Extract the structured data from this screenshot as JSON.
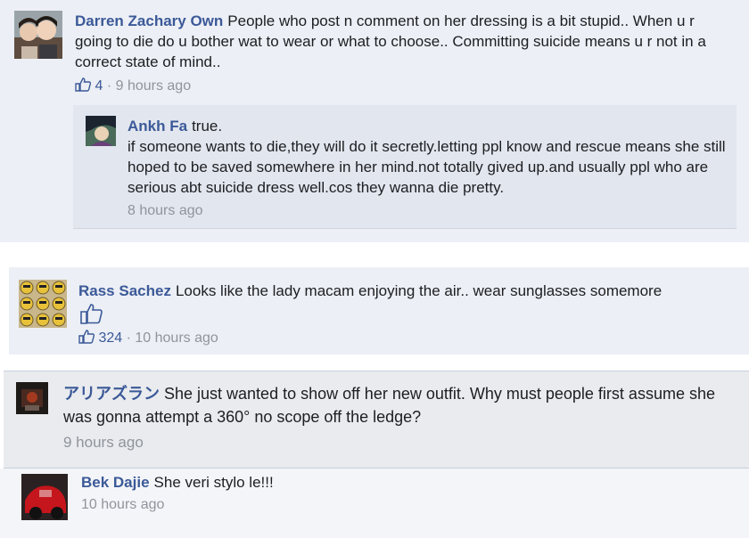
{
  "comments": [
    {
      "author": "Darren Zachary Own",
      "text": "People who post n comment on her dressing is a bit stupid.. When u r going to die do u bother wat to wear or what to choose.. Committing suicide means u r not in a correct state of mind..",
      "likes": "4",
      "time": "9 hours ago",
      "reply": {
        "author": "Ankh Fa",
        "text_first": "true.",
        "text_rest": "if someone wants to die,they will do it secretly.letting ppl know and rescue means she still hoped to be saved somewhere in her mind.not totally gived up.and usually ppl who are serious abt suicide dress well.cos they wanna die pretty.",
        "time": "8 hours ago"
      }
    },
    {
      "author": "Rass Sachez",
      "text": "Looks like the lady macam enjoying the air.. wear sunglasses somemore",
      "likes": "324",
      "time": "10 hours ago"
    },
    {
      "author": "アリアズラン",
      "text": "She just wanted to show off her new outfit. Why must people first assume she was gonna attempt a 360° no scope off the ledge?",
      "time": "9 hours ago"
    },
    {
      "author": "Bek Dajie",
      "text": "She veri stylo le!!!",
      "time": "10 hours ago"
    }
  ],
  "meta_separator": "·",
  "icons": {
    "like": "thumbs-up-icon"
  },
  "colors": {
    "link": "#3b5998",
    "meta": "#90949c",
    "panel": "#eceff5"
  }
}
